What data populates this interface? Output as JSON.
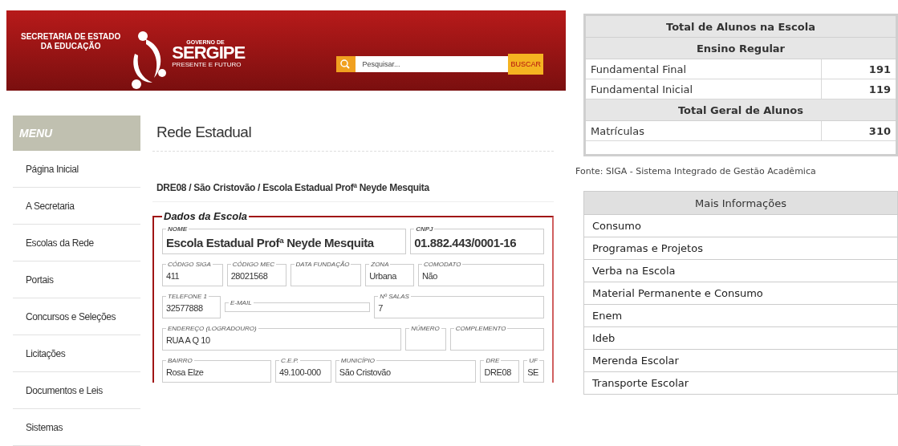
{
  "header": {
    "department_lines": [
      "SECRETARIA DE ESTADO",
      "DA EDUCAÇÃO"
    ],
    "logo": {
      "top": "GOVERNO DE",
      "name": "SERGIPE",
      "tagline": "PRESENTE E FUTURO"
    },
    "search": {
      "placeholder": "Pesquisar...",
      "button": "BUSCAR"
    }
  },
  "menu": {
    "title": "MENU",
    "items": [
      "Página Inicial",
      "A Secretaria",
      "Escolas da Rede",
      "Portais",
      "Concursos e Seleções",
      "Licitações",
      "Documentos e Leis",
      "Sistemas"
    ]
  },
  "content": {
    "title": "Rede Estadual",
    "breadcrumb": "DRE08 / São Cristovão / Escola Estadual Profª Neyde Mesquita",
    "fieldset": {
      "legend": "Dados da Escola",
      "groups": [
        {
          "fields": [
            {
              "label": "NOME",
              "value": "Escola Estadual Profª Neyde Mesquita"
            },
            {
              "label": "CNPJ",
              "value": "01.882.443/0001-16"
            }
          ]
        },
        {
          "fields": [
            {
              "label": "CÓDIGO SIGA",
              "value": "411"
            },
            {
              "label": "CÓDIGO MEC",
              "value": "28021568"
            },
            {
              "label": "DATA FUNDAÇÃO"
            },
            {
              "label": "ZONA",
              "value": "Urbana"
            },
            {
              "label": "COMODATO",
              "value": "Não"
            }
          ]
        },
        {
          "fields": [
            {
              "label": "TELEFONE 1",
              "value": "32577888"
            },
            {
              "label": "E-MAIL"
            },
            {
              "label": "Nº SALAS",
              "value": "7"
            }
          ]
        },
        {
          "fields": [
            {
              "label": "ENDEREÇO (LOGRADOURO)",
              "value": "RUA A Q 10"
            },
            {
              "label": "NÚMERO"
            },
            {
              "label": "COMPLEMENTO"
            }
          ]
        },
        {
          "fields": [
            {
              "label": "BAIRRO",
              "value": "Rosa Elze"
            },
            {
              "label": "C.E.P.",
              "value": "49.100-000"
            },
            {
              "label": "MUNICÍPIO",
              "value": "São Cristovão"
            },
            {
              "label": "DRE",
              "value": "DRE08"
            },
            {
              "label": "UF",
              "value": "SE"
            }
          ]
        }
      ]
    }
  },
  "students": {
    "title": "Total de Alunos na Escola",
    "sections": [
      {
        "heading": "Ensino Regular",
        "rows": [
          {
            "label": "Fundamental Final",
            "value": "191"
          },
          {
            "label": "Fundamental Inicial",
            "value": "119"
          }
        ]
      },
      {
        "heading": "Total Geral de Alunos",
        "rows": [
          {
            "label": "Matrículas",
            "value": "310"
          }
        ]
      }
    ],
    "source": "Fonte: SIGA - Sistema Integrado de Gestão Acadêmica"
  },
  "info": {
    "title": "Mais Informações",
    "items": [
      "Consumo",
      "Programas e Projetos",
      "Verba na Escola",
      "Material Permanente e Consumo",
      "Enem",
      "Ideb",
      "Merenda Escolar",
      "Transporte Escolar"
    ]
  }
}
